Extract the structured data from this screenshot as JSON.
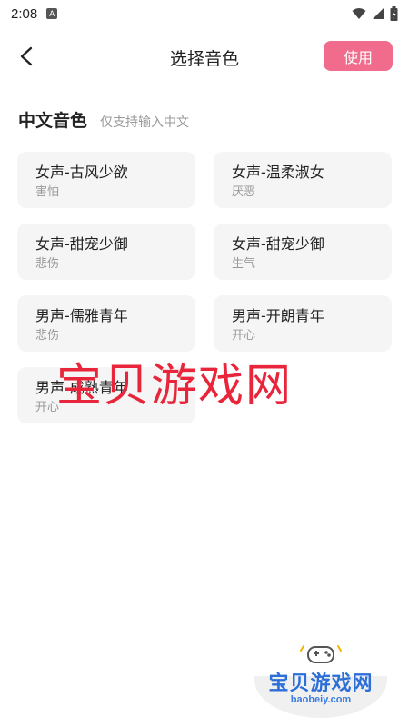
{
  "status_bar": {
    "time": "2:08",
    "notification_glyph": "A",
    "icons": [
      "wifi-icon",
      "signal-icon",
      "battery-icon"
    ]
  },
  "header": {
    "title": "选择音色",
    "back_icon": "back-arrow-icon",
    "use_label": "使用",
    "accent_color": "#f06b8c"
  },
  "section": {
    "title": "中文音色",
    "hint": "仅支持输入中文"
  },
  "voices": [
    {
      "name": "女声-古风少欲",
      "mood": "害怕"
    },
    {
      "name": "女声-温柔淑女",
      "mood": "厌恶"
    },
    {
      "name": "女声-甜宠少御",
      "mood": "悲伤"
    },
    {
      "name": "女声-甜宠少御",
      "mood": "生气"
    },
    {
      "name": "男声-儒雅青年",
      "mood": "悲伤"
    },
    {
      "name": "男声-开朗青年",
      "mood": "开心"
    },
    {
      "name": "男声-成熟青年",
      "mood": "开心"
    }
  ],
  "watermark": {
    "text": "宝贝游戏网",
    "color": "#e8253a"
  },
  "logo": {
    "text": "宝贝游戏网",
    "url": "baobeiy.com",
    "color": "#2d6fd8"
  }
}
